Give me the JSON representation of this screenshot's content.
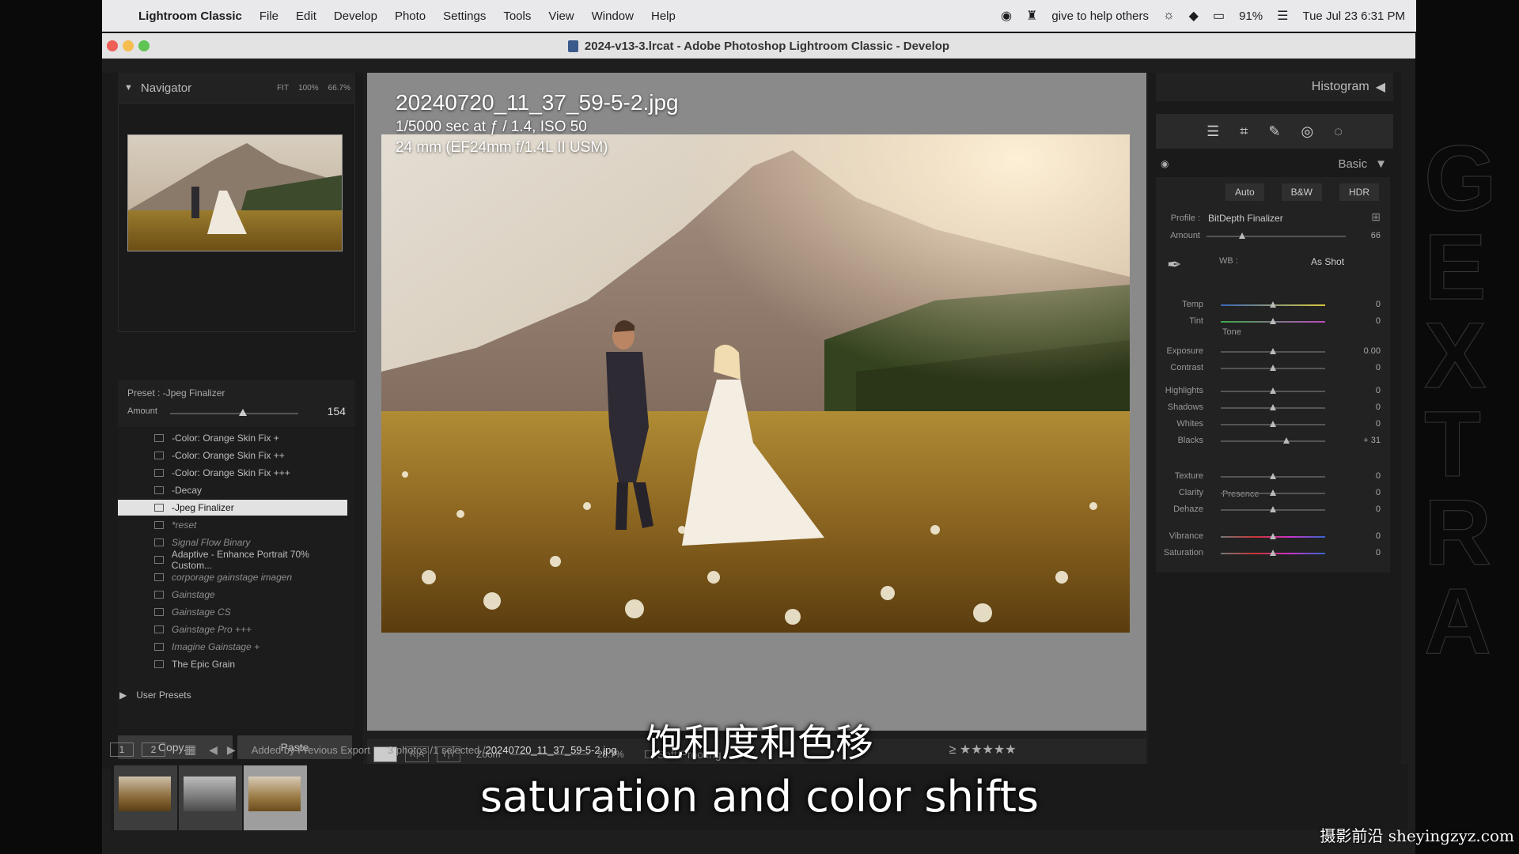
{
  "menubar": {
    "app_name": "Lightroom Classic",
    "items": [
      "File",
      "Edit",
      "Develop",
      "Photo",
      "Settings",
      "Tools",
      "View",
      "Window",
      "Help"
    ],
    "status_text": "give to help others",
    "battery": "91%",
    "datetime": "Tue Jul 23  6:31 PM"
  },
  "window": {
    "title": "2024-v13-3.lrcat - Adobe Photoshop Lightroom Classic - Develop"
  },
  "navigator": {
    "title": "Navigator",
    "zoom_options": [
      "FIT",
      "100%",
      "66.7%"
    ]
  },
  "preset_amount": {
    "preset_label": "Preset : -Jpeg Finalizer",
    "amount_label": "Amount",
    "amount_value": "154",
    "amount_fraction": 0.85
  },
  "presets": [
    {
      "name": "-Color: Orange Skin Fix +",
      "italic": false
    },
    {
      "name": "-Color: Orange Skin Fix ++",
      "italic": false
    },
    {
      "name": "-Color: Orange Skin Fix +++",
      "italic": false
    },
    {
      "name": "-Decay",
      "italic": false
    },
    {
      "name": "-Jpeg Finalizer",
      "italic": false,
      "selected": true
    },
    {
      "name": "*reset",
      "italic": true
    },
    {
      "name": "Signal Flow Binary",
      "italic": true
    },
    {
      "name": "Adaptive - Enhance Portrait 70% Custom...",
      "italic": false
    },
    {
      "name": "corporage gainstage imagen",
      "italic": true
    },
    {
      "name": "Gainstage",
      "italic": true
    },
    {
      "name": "Gainstage CS",
      "italic": true
    },
    {
      "name": "Gainstage Pro +++",
      "italic": true
    },
    {
      "name": "Imagine Gainstage +",
      "italic": true
    },
    {
      "name": "The Epic Grain",
      "italic": false
    }
  ],
  "user_presets_label": "User Presets",
  "copy_label": "Copy...",
  "paste_label": "Paste",
  "photo_info": {
    "filename": "20240720_11_37_59-5-2.jpg",
    "exposure": "1/5000 sec at ƒ / 1.4, ISO 50",
    "lens": "24 mm (EF24mm f/1.4L II USM)"
  },
  "center_toolbar": {
    "zoom_label": "Zoom",
    "zoom_value": "28.7%",
    "soft_proofing": "Soft Proofing"
  },
  "right_panel": {
    "histogram_title": "Histogram",
    "basic_title": "Basic",
    "buttons": [
      "Auto",
      "B&W",
      "HDR"
    ],
    "profile_label": "Profile :",
    "profile_value": "BitDepth Finalizer",
    "amount_label": "Amount",
    "amount_value": "66",
    "wb_label": "WB :",
    "wb_value": "As Shot",
    "tone_label": "Tone",
    "presence_label": "Presence",
    "sliders": [
      {
        "label": "Temp",
        "value": "0"
      },
      {
        "label": "Tint",
        "value": "0"
      },
      {
        "label": "Exposure",
        "value": "0.00"
      },
      {
        "label": "Contrast",
        "value": "0"
      },
      {
        "label": "Highlights",
        "value": "0"
      },
      {
        "label": "Shadows",
        "value": "0"
      },
      {
        "label": "Whites",
        "value": "0"
      },
      {
        "label": "Blacks",
        "value": "+ 31"
      },
      {
        "label": "Texture",
        "value": "0"
      },
      {
        "label": "Clarity",
        "value": "0"
      },
      {
        "label": "Dehaze",
        "value": "0"
      },
      {
        "label": "Vibrance",
        "value": "0"
      },
      {
        "label": "Saturation",
        "value": "0"
      }
    ]
  },
  "filmstrip": {
    "page1": "1",
    "page2": "2",
    "source": "Added by Previous Export",
    "count": "3 photos /1 selected /",
    "current_file": "20240720_11_37_59-5-2.jpg"
  },
  "subtitles": {
    "zh": "饱和度和色移",
    "en": "saturation and color shifts"
  },
  "watermark": "摄影前沿 sheyingzyz.com"
}
